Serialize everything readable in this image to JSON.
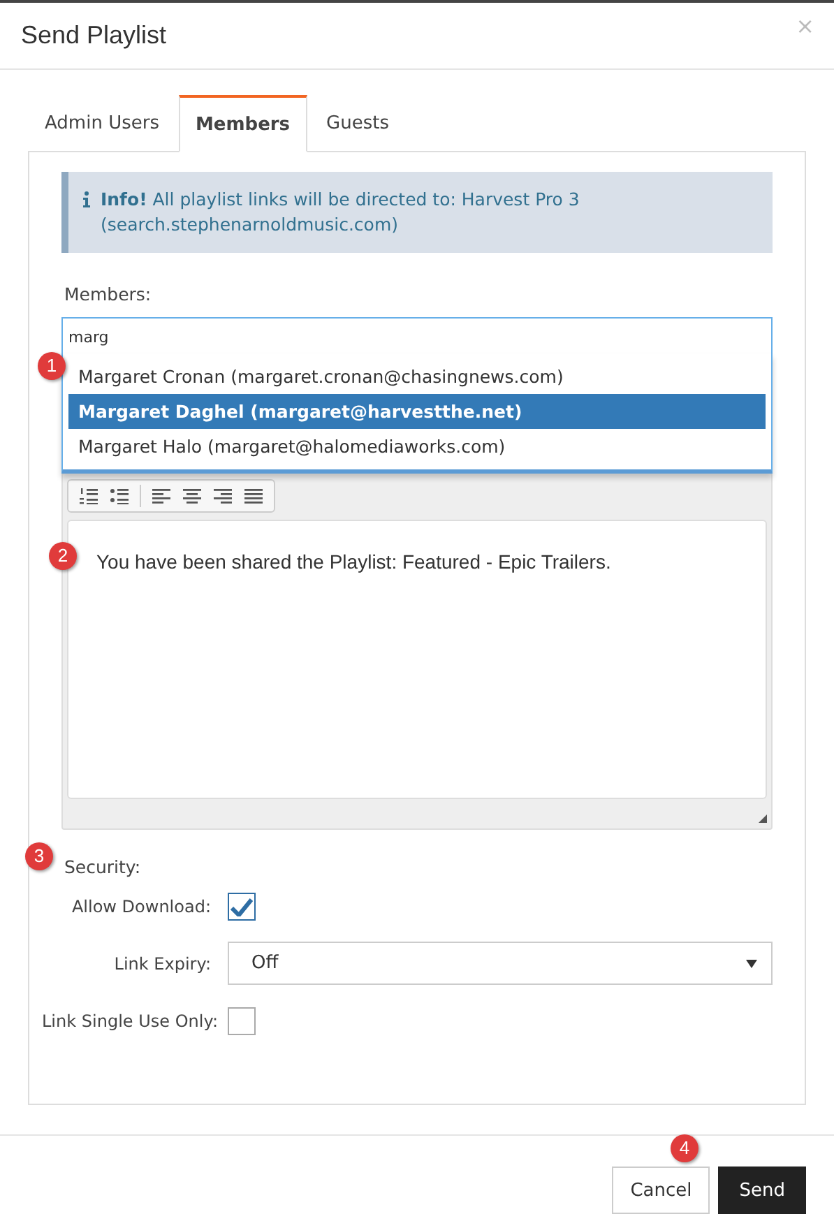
{
  "dialog": {
    "title": "Send Playlist",
    "close": "×"
  },
  "tabs": [
    {
      "label": "Admin Users",
      "selected": false
    },
    {
      "label": "Members",
      "selected": true
    },
    {
      "label": "Guests",
      "selected": false
    }
  ],
  "info": {
    "label": "Info!",
    "text": "All playlist links will be directed to: Harvest Pro 3 (search.stephenarnoldmusic.com)"
  },
  "members": {
    "label": "Members:",
    "value": "marg",
    "suggestions": [
      {
        "text": "Margaret Cronan (margaret.cronan@chasingnews.com)",
        "selected": false
      },
      {
        "text": "Margaret Daghel (margaret@harvestthe.net)",
        "selected": true
      },
      {
        "text": "Margaret Halo (margaret@halomediaworks.com)",
        "selected": false
      }
    ]
  },
  "editor": {
    "message": "You have been shared the Playlist: Featured - Epic Trailers."
  },
  "security": {
    "label": "Security:",
    "fields": [
      {
        "kind": "checkbox",
        "label": "Allow Download:",
        "checked": true
      },
      {
        "kind": "select",
        "label": "Link Expiry:",
        "value": "Off"
      },
      {
        "kind": "checkbox",
        "label": "Link Single Use Only:",
        "checked": false
      }
    ]
  },
  "buttons": [
    {
      "label": "Cancel",
      "kind": "default"
    },
    {
      "label": "Send",
      "kind": "primary"
    }
  ],
  "callouts": [
    "1",
    "2",
    "3",
    "4"
  ]
}
